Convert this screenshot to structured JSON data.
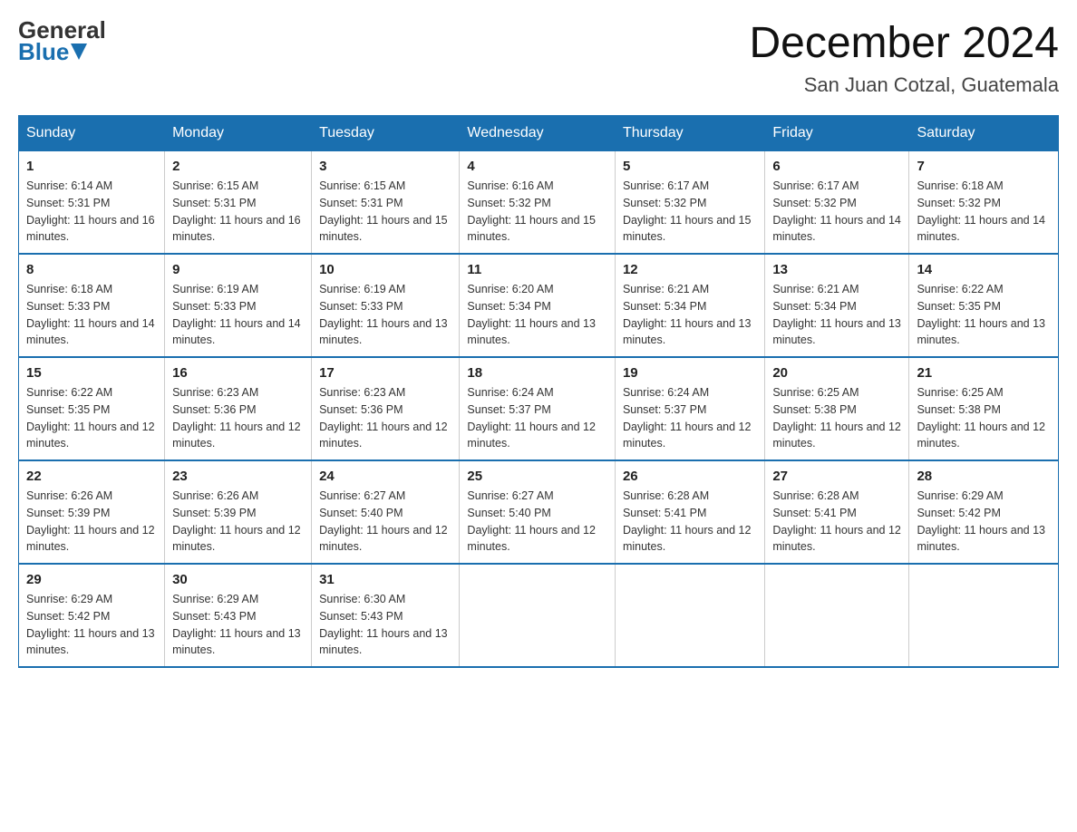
{
  "logo": {
    "text_general": "General",
    "text_blue": "Blue",
    "triangle_color": "#1a6faf"
  },
  "title": "December 2024",
  "subtitle": "San Juan Cotzal, Guatemala",
  "days_of_week": [
    "Sunday",
    "Monday",
    "Tuesday",
    "Wednesday",
    "Thursday",
    "Friday",
    "Saturday"
  ],
  "weeks": [
    [
      {
        "day": "1",
        "sunrise": "6:14 AM",
        "sunset": "5:31 PM",
        "daylight": "11 hours and 16 minutes."
      },
      {
        "day": "2",
        "sunrise": "6:15 AM",
        "sunset": "5:31 PM",
        "daylight": "11 hours and 16 minutes."
      },
      {
        "day": "3",
        "sunrise": "6:15 AM",
        "sunset": "5:31 PM",
        "daylight": "11 hours and 15 minutes."
      },
      {
        "day": "4",
        "sunrise": "6:16 AM",
        "sunset": "5:32 PM",
        "daylight": "11 hours and 15 minutes."
      },
      {
        "day": "5",
        "sunrise": "6:17 AM",
        "sunset": "5:32 PM",
        "daylight": "11 hours and 15 minutes."
      },
      {
        "day": "6",
        "sunrise": "6:17 AM",
        "sunset": "5:32 PM",
        "daylight": "11 hours and 14 minutes."
      },
      {
        "day": "7",
        "sunrise": "6:18 AM",
        "sunset": "5:32 PM",
        "daylight": "11 hours and 14 minutes."
      }
    ],
    [
      {
        "day": "8",
        "sunrise": "6:18 AM",
        "sunset": "5:33 PM",
        "daylight": "11 hours and 14 minutes."
      },
      {
        "day": "9",
        "sunrise": "6:19 AM",
        "sunset": "5:33 PM",
        "daylight": "11 hours and 14 minutes."
      },
      {
        "day": "10",
        "sunrise": "6:19 AM",
        "sunset": "5:33 PM",
        "daylight": "11 hours and 13 minutes."
      },
      {
        "day": "11",
        "sunrise": "6:20 AM",
        "sunset": "5:34 PM",
        "daylight": "11 hours and 13 minutes."
      },
      {
        "day": "12",
        "sunrise": "6:21 AM",
        "sunset": "5:34 PM",
        "daylight": "11 hours and 13 minutes."
      },
      {
        "day": "13",
        "sunrise": "6:21 AM",
        "sunset": "5:34 PM",
        "daylight": "11 hours and 13 minutes."
      },
      {
        "day": "14",
        "sunrise": "6:22 AM",
        "sunset": "5:35 PM",
        "daylight": "11 hours and 13 minutes."
      }
    ],
    [
      {
        "day": "15",
        "sunrise": "6:22 AM",
        "sunset": "5:35 PM",
        "daylight": "11 hours and 12 minutes."
      },
      {
        "day": "16",
        "sunrise": "6:23 AM",
        "sunset": "5:36 PM",
        "daylight": "11 hours and 12 minutes."
      },
      {
        "day": "17",
        "sunrise": "6:23 AM",
        "sunset": "5:36 PM",
        "daylight": "11 hours and 12 minutes."
      },
      {
        "day": "18",
        "sunrise": "6:24 AM",
        "sunset": "5:37 PM",
        "daylight": "11 hours and 12 minutes."
      },
      {
        "day": "19",
        "sunrise": "6:24 AM",
        "sunset": "5:37 PM",
        "daylight": "11 hours and 12 minutes."
      },
      {
        "day": "20",
        "sunrise": "6:25 AM",
        "sunset": "5:38 PM",
        "daylight": "11 hours and 12 minutes."
      },
      {
        "day": "21",
        "sunrise": "6:25 AM",
        "sunset": "5:38 PM",
        "daylight": "11 hours and 12 minutes."
      }
    ],
    [
      {
        "day": "22",
        "sunrise": "6:26 AM",
        "sunset": "5:39 PM",
        "daylight": "11 hours and 12 minutes."
      },
      {
        "day": "23",
        "sunrise": "6:26 AM",
        "sunset": "5:39 PM",
        "daylight": "11 hours and 12 minutes."
      },
      {
        "day": "24",
        "sunrise": "6:27 AM",
        "sunset": "5:40 PM",
        "daylight": "11 hours and 12 minutes."
      },
      {
        "day": "25",
        "sunrise": "6:27 AM",
        "sunset": "5:40 PM",
        "daylight": "11 hours and 12 minutes."
      },
      {
        "day": "26",
        "sunrise": "6:28 AM",
        "sunset": "5:41 PM",
        "daylight": "11 hours and 12 minutes."
      },
      {
        "day": "27",
        "sunrise": "6:28 AM",
        "sunset": "5:41 PM",
        "daylight": "11 hours and 12 minutes."
      },
      {
        "day": "28",
        "sunrise": "6:29 AM",
        "sunset": "5:42 PM",
        "daylight": "11 hours and 13 minutes."
      }
    ],
    [
      {
        "day": "29",
        "sunrise": "6:29 AM",
        "sunset": "5:42 PM",
        "daylight": "11 hours and 13 minutes."
      },
      {
        "day": "30",
        "sunrise": "6:29 AM",
        "sunset": "5:43 PM",
        "daylight": "11 hours and 13 minutes."
      },
      {
        "day": "31",
        "sunrise": "6:30 AM",
        "sunset": "5:43 PM",
        "daylight": "11 hours and 13 minutes."
      },
      null,
      null,
      null,
      null
    ]
  ]
}
